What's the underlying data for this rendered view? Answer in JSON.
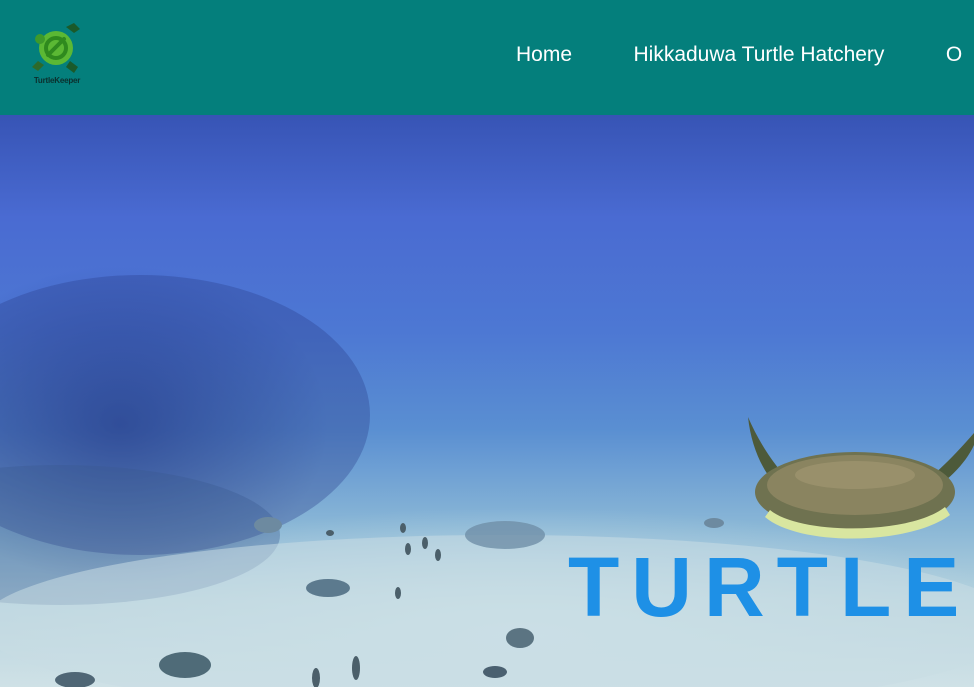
{
  "brand": {
    "logo_text": "TurtleKeeper",
    "logo_icon": "turtle-logo-icon",
    "colors": {
      "header": "#047f7c",
      "logo_green": "#4caf2e",
      "title": "#1e90e6"
    }
  },
  "nav": {
    "items": [
      {
        "label": "Home"
      },
      {
        "label": "Hikkaduwa Turtle Hatchery"
      },
      {
        "label": "O"
      }
    ]
  },
  "hero": {
    "title": "TURTLEK",
    "image": "underwater-turtle-photo"
  }
}
